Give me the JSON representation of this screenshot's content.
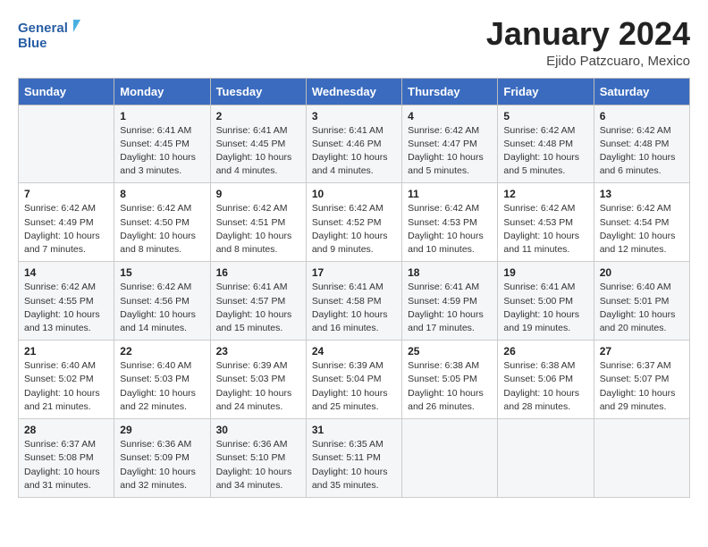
{
  "header": {
    "logo_line1": "General",
    "logo_line2": "Blue",
    "title": "January 2024",
    "subtitle": "Ejido Patzcuaro, Mexico"
  },
  "days_of_week": [
    "Sunday",
    "Monday",
    "Tuesday",
    "Wednesday",
    "Thursday",
    "Friday",
    "Saturday"
  ],
  "weeks": [
    [
      {
        "num": "",
        "info": ""
      },
      {
        "num": "1",
        "info": "Sunrise: 6:41 AM\nSunset: 4:45 PM\nDaylight: 10 hours\nand 3 minutes."
      },
      {
        "num": "2",
        "info": "Sunrise: 6:41 AM\nSunset: 4:45 PM\nDaylight: 10 hours\nand 4 minutes."
      },
      {
        "num": "3",
        "info": "Sunrise: 6:41 AM\nSunset: 4:46 PM\nDaylight: 10 hours\nand 4 minutes."
      },
      {
        "num": "4",
        "info": "Sunrise: 6:42 AM\nSunset: 4:47 PM\nDaylight: 10 hours\nand 5 minutes."
      },
      {
        "num": "5",
        "info": "Sunrise: 6:42 AM\nSunset: 4:48 PM\nDaylight: 10 hours\nand 5 minutes."
      },
      {
        "num": "6",
        "info": "Sunrise: 6:42 AM\nSunset: 4:48 PM\nDaylight: 10 hours\nand 6 minutes."
      }
    ],
    [
      {
        "num": "7",
        "info": "Sunrise: 6:42 AM\nSunset: 4:49 PM\nDaylight: 10 hours\nand 7 minutes."
      },
      {
        "num": "8",
        "info": "Sunrise: 6:42 AM\nSunset: 4:50 PM\nDaylight: 10 hours\nand 8 minutes."
      },
      {
        "num": "9",
        "info": "Sunrise: 6:42 AM\nSunset: 4:51 PM\nDaylight: 10 hours\nand 8 minutes."
      },
      {
        "num": "10",
        "info": "Sunrise: 6:42 AM\nSunset: 4:52 PM\nDaylight: 10 hours\nand 9 minutes."
      },
      {
        "num": "11",
        "info": "Sunrise: 6:42 AM\nSunset: 4:53 PM\nDaylight: 10 hours\nand 10 minutes."
      },
      {
        "num": "12",
        "info": "Sunrise: 6:42 AM\nSunset: 4:53 PM\nDaylight: 10 hours\nand 11 minutes."
      },
      {
        "num": "13",
        "info": "Sunrise: 6:42 AM\nSunset: 4:54 PM\nDaylight: 10 hours\nand 12 minutes."
      }
    ],
    [
      {
        "num": "14",
        "info": "Sunrise: 6:42 AM\nSunset: 4:55 PM\nDaylight: 10 hours\nand 13 minutes."
      },
      {
        "num": "15",
        "info": "Sunrise: 6:42 AM\nSunset: 4:56 PM\nDaylight: 10 hours\nand 14 minutes."
      },
      {
        "num": "16",
        "info": "Sunrise: 6:41 AM\nSunset: 4:57 PM\nDaylight: 10 hours\nand 15 minutes."
      },
      {
        "num": "17",
        "info": "Sunrise: 6:41 AM\nSunset: 4:58 PM\nDaylight: 10 hours\nand 16 minutes."
      },
      {
        "num": "18",
        "info": "Sunrise: 6:41 AM\nSunset: 4:59 PM\nDaylight: 10 hours\nand 17 minutes."
      },
      {
        "num": "19",
        "info": "Sunrise: 6:41 AM\nSunset: 5:00 PM\nDaylight: 10 hours\nand 19 minutes."
      },
      {
        "num": "20",
        "info": "Sunrise: 6:40 AM\nSunset: 5:01 PM\nDaylight: 10 hours\nand 20 minutes."
      }
    ],
    [
      {
        "num": "21",
        "info": "Sunrise: 6:40 AM\nSunset: 5:02 PM\nDaylight: 10 hours\nand 21 minutes."
      },
      {
        "num": "22",
        "info": "Sunrise: 6:40 AM\nSunset: 5:03 PM\nDaylight: 10 hours\nand 22 minutes."
      },
      {
        "num": "23",
        "info": "Sunrise: 6:39 AM\nSunset: 5:03 PM\nDaylight: 10 hours\nand 24 minutes."
      },
      {
        "num": "24",
        "info": "Sunrise: 6:39 AM\nSunset: 5:04 PM\nDaylight: 10 hours\nand 25 minutes."
      },
      {
        "num": "25",
        "info": "Sunrise: 6:38 AM\nSunset: 5:05 PM\nDaylight: 10 hours\nand 26 minutes."
      },
      {
        "num": "26",
        "info": "Sunrise: 6:38 AM\nSunset: 5:06 PM\nDaylight: 10 hours\nand 28 minutes."
      },
      {
        "num": "27",
        "info": "Sunrise: 6:37 AM\nSunset: 5:07 PM\nDaylight: 10 hours\nand 29 minutes."
      }
    ],
    [
      {
        "num": "28",
        "info": "Sunrise: 6:37 AM\nSunset: 5:08 PM\nDaylight: 10 hours\nand 31 minutes."
      },
      {
        "num": "29",
        "info": "Sunrise: 6:36 AM\nSunset: 5:09 PM\nDaylight: 10 hours\nand 32 minutes."
      },
      {
        "num": "30",
        "info": "Sunrise: 6:36 AM\nSunset: 5:10 PM\nDaylight: 10 hours\nand 34 minutes."
      },
      {
        "num": "31",
        "info": "Sunrise: 6:35 AM\nSunset: 5:11 PM\nDaylight: 10 hours\nand 35 minutes."
      },
      {
        "num": "",
        "info": ""
      },
      {
        "num": "",
        "info": ""
      },
      {
        "num": "",
        "info": ""
      }
    ]
  ]
}
